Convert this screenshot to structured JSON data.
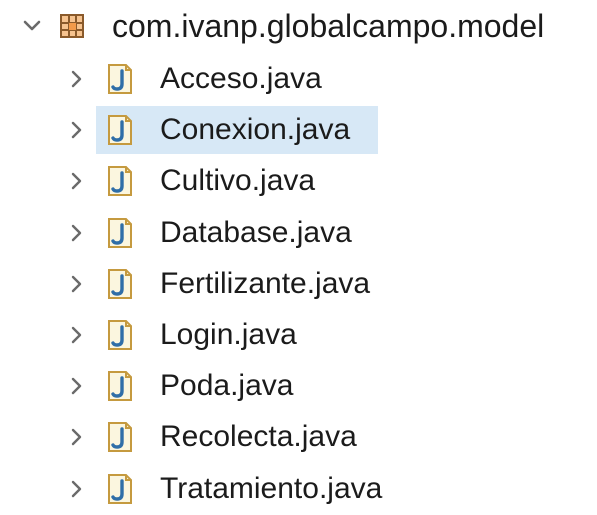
{
  "package": {
    "name": "com.ivanp.globalcampo.model",
    "expanded": true,
    "icon": "package-icon",
    "chevron": "chevron-down-icon"
  },
  "files": [
    {
      "name": "Acceso.java",
      "icon": "java-file-icon",
      "chevron": "chevron-right-icon",
      "selected": false
    },
    {
      "name": "Conexion.java",
      "icon": "java-file-icon",
      "chevron": "chevron-right-icon",
      "selected": true
    },
    {
      "name": "Cultivo.java",
      "icon": "java-file-icon",
      "chevron": "chevron-right-icon",
      "selected": false
    },
    {
      "name": "Database.java",
      "icon": "java-file-icon",
      "chevron": "chevron-right-icon",
      "selected": false
    },
    {
      "name": "Fertilizante.java",
      "icon": "java-file-icon",
      "chevron": "chevron-right-icon",
      "selected": false
    },
    {
      "name": "Login.java",
      "icon": "java-file-icon",
      "chevron": "chevron-right-icon",
      "selected": false
    },
    {
      "name": "Poda.java",
      "icon": "java-file-icon",
      "chevron": "chevron-right-icon",
      "selected": false
    },
    {
      "name": "Recolecta.java",
      "icon": "java-file-icon",
      "chevron": "chevron-right-icon",
      "selected": false
    },
    {
      "name": "Tratamiento.java",
      "icon": "java-file-icon",
      "chevron": "chevron-right-icon",
      "selected": false
    }
  ],
  "colors": {
    "selection": "#d7e8f6",
    "package_brown": "#8a5a2b",
    "package_orange": "#f29a4a",
    "java_blue": "#2f6ea8",
    "java_border": "#c59a3f",
    "java_bg": "#fbf6df",
    "chevron": "#6a6a6a"
  }
}
